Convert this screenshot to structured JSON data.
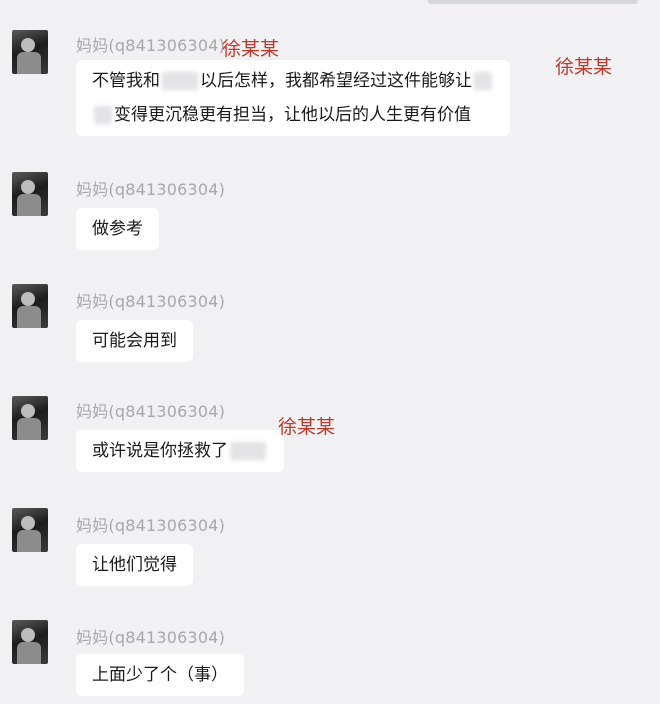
{
  "chat": {
    "messages": [
      {
        "sender": "妈妈(q841306304)",
        "lines": [
          "不管我和",
          "以后怎样，我都希望经过这件能够让",
          "变得更沉稳更有担当，让他以后的人生更有价值"
        ]
      },
      {
        "sender": "妈妈(q841306304)",
        "text": "做参考"
      },
      {
        "sender": "妈妈(q841306304)",
        "text": "可能会用到"
      },
      {
        "sender": "妈妈(q841306304)",
        "text": "或许说是你拯救了"
      },
      {
        "sender": "妈妈(q841306304)",
        "text": "让他们觉得"
      },
      {
        "sender": "妈妈(q841306304)",
        "text": "上面少了个（事）"
      }
    ]
  },
  "annotations": {
    "name_label_1": "徐某某",
    "name_label_2": "徐某某",
    "name_label_3": "徐某某"
  }
}
